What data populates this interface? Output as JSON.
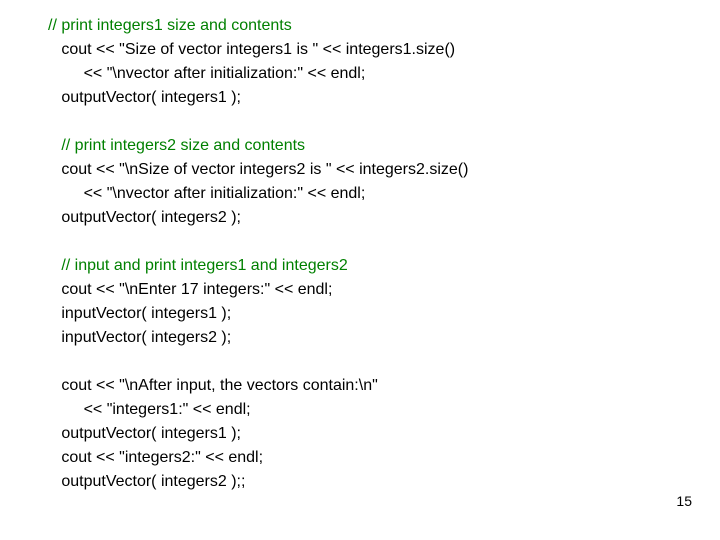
{
  "code": {
    "c1": "// print integers1 size and contents",
    "l2": "   cout << \"Size of vector integers1 is \" << integers1.size()",
    "l3": "        << \"\\nvector after initialization:\" << endl;",
    "l4": "   outputVector( integers1 );",
    "l5": "",
    "c6": "   // print integers2 size and contents",
    "l7": "   cout << \"\\nSize of vector integers2 is \" << integers2.size()",
    "l8": "        << \"\\nvector after initialization:\" << endl;",
    "l9": "   outputVector( integers2 );",
    "l10": "",
    "c11": "   // input and print integers1 and integers2",
    "l12": "   cout << \"\\nEnter 17 integers:\" << endl;",
    "l13": "   inputVector( integers1 );",
    "l14": "   inputVector( integers2 );",
    "l15": "",
    "l16": "   cout << \"\\nAfter input, the vectors contain:\\n\"",
    "l17": "        << \"integers1:\" << endl;",
    "l18": "   outputVector( integers1 );",
    "l19": "   cout << \"integers2:\" << endl;",
    "l20": "   outputVector( integers2 );;"
  },
  "page_number": "15"
}
